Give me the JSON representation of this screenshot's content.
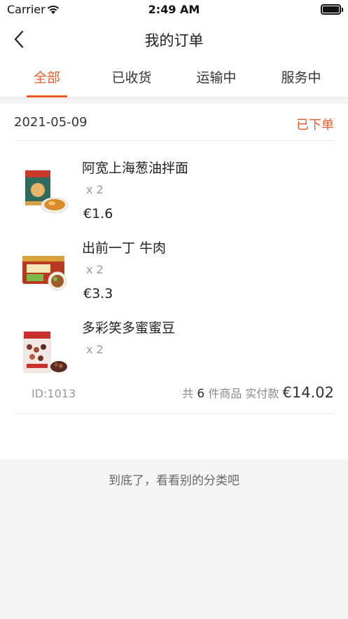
{
  "status_bar": {
    "carrier": "Carrier",
    "time": "2:49 AM"
  },
  "nav": {
    "title": "我的订单"
  },
  "tabs": [
    {
      "label": "全部",
      "active": true
    },
    {
      "label": "已收货",
      "active": false
    },
    {
      "label": "运输中",
      "active": false
    },
    {
      "label": "服务中",
      "active": false
    }
  ],
  "order": {
    "date": "2021-05-09",
    "status": "已下单",
    "items": [
      {
        "name": "阿宽上海葱油拌面",
        "qty": "x 2",
        "price": "€1.6"
      },
      {
        "name": "出前一丁 牛肉",
        "qty": "x 2",
        "price": "€3.3"
      },
      {
        "name": "多彩笑多蜜蜜豆",
        "qty": "x 2",
        "price": ""
      }
    ],
    "id_label": "ID:1013",
    "total_prefix": "共",
    "total_count": "6",
    "total_mid": "件商品 实付款",
    "total_amount": "€14.02"
  },
  "end_message": "到底了，看看别的分类吧",
  "colors": {
    "accent": "#ef5a24",
    "background": "#f5f5f5"
  }
}
